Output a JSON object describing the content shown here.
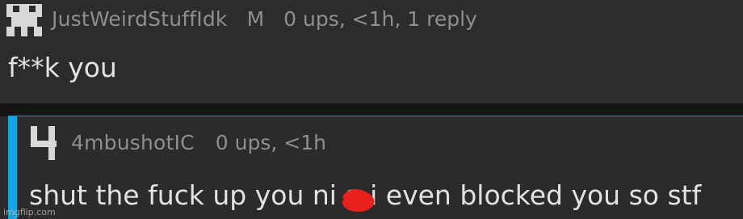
{
  "comment": {
    "username": "JustWeirdStuffIdk",
    "badge": "M",
    "stats": "0 ups, <1h, 1 reply",
    "text": "f**k you",
    "avatar_icon": "pixel-avatar-icon"
  },
  "reply": {
    "username": "4mbushotIC",
    "stats": "0 ups, <1h",
    "text": "shut the fuck up you ni   a i even blocked you so stf",
    "avatar_icon": "pixel-avatar-icon",
    "accent_color": "#15a4e0"
  },
  "redaction": {
    "color": "#e8211f",
    "icon": "red-scribble-redaction"
  },
  "watermark": "imgflip.com"
}
